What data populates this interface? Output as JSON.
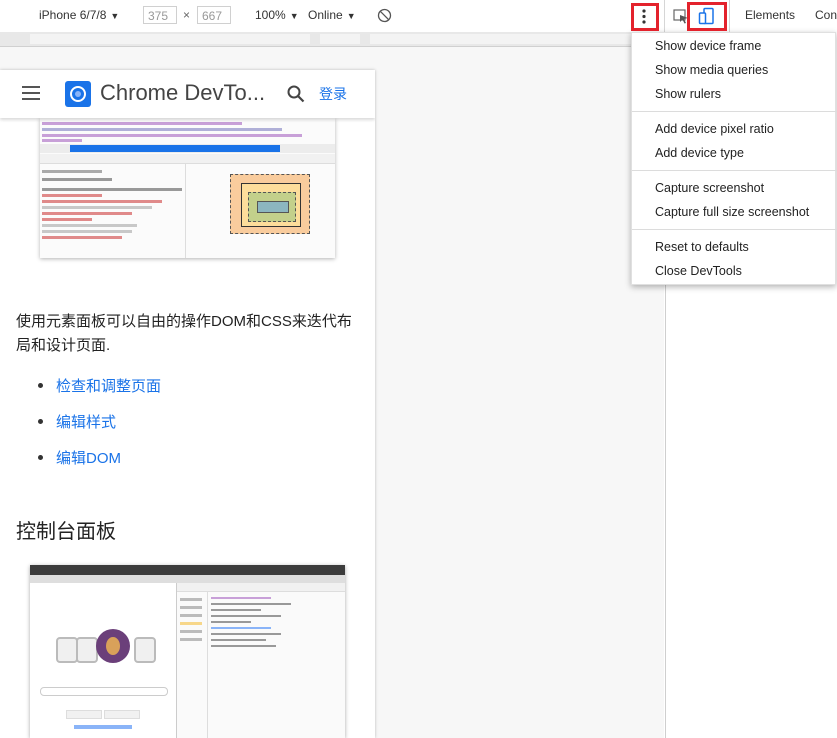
{
  "toolbar": {
    "device": "iPhone 6/7/8",
    "width": "375",
    "times": "×",
    "height": "667",
    "zoom": "100%",
    "network": "Online",
    "caret": "▼"
  },
  "devtools_tabs": [
    "Elements",
    "Con"
  ],
  "page": {
    "app_title": "Chrome DevTo...",
    "login": "登录",
    "paragraph": "使用元素面板可以自由的操作DOM和CSS来迭代布局和设计页面.",
    "links": [
      "检查和调整页面",
      "编辑样式",
      "编辑DOM"
    ],
    "heading": "控制台面板"
  },
  "menu": {
    "items": [
      "Show device frame",
      "Show media queries",
      "Show rulers",
      "Add device pixel ratio",
      "Add device type",
      "Capture screenshot",
      "Capture full size screenshot",
      "Reset to defaults",
      "Close DevTools"
    ]
  },
  "colors": {
    "accent": "#1a73e8",
    "highlight": "#e3222c"
  },
  "icons": [
    "more-vert-icon",
    "inspect-element-icon",
    "device-toolbar-icon",
    "rotate-icon",
    "menu-icon",
    "search-icon",
    "devtools-logo-icon"
  ]
}
